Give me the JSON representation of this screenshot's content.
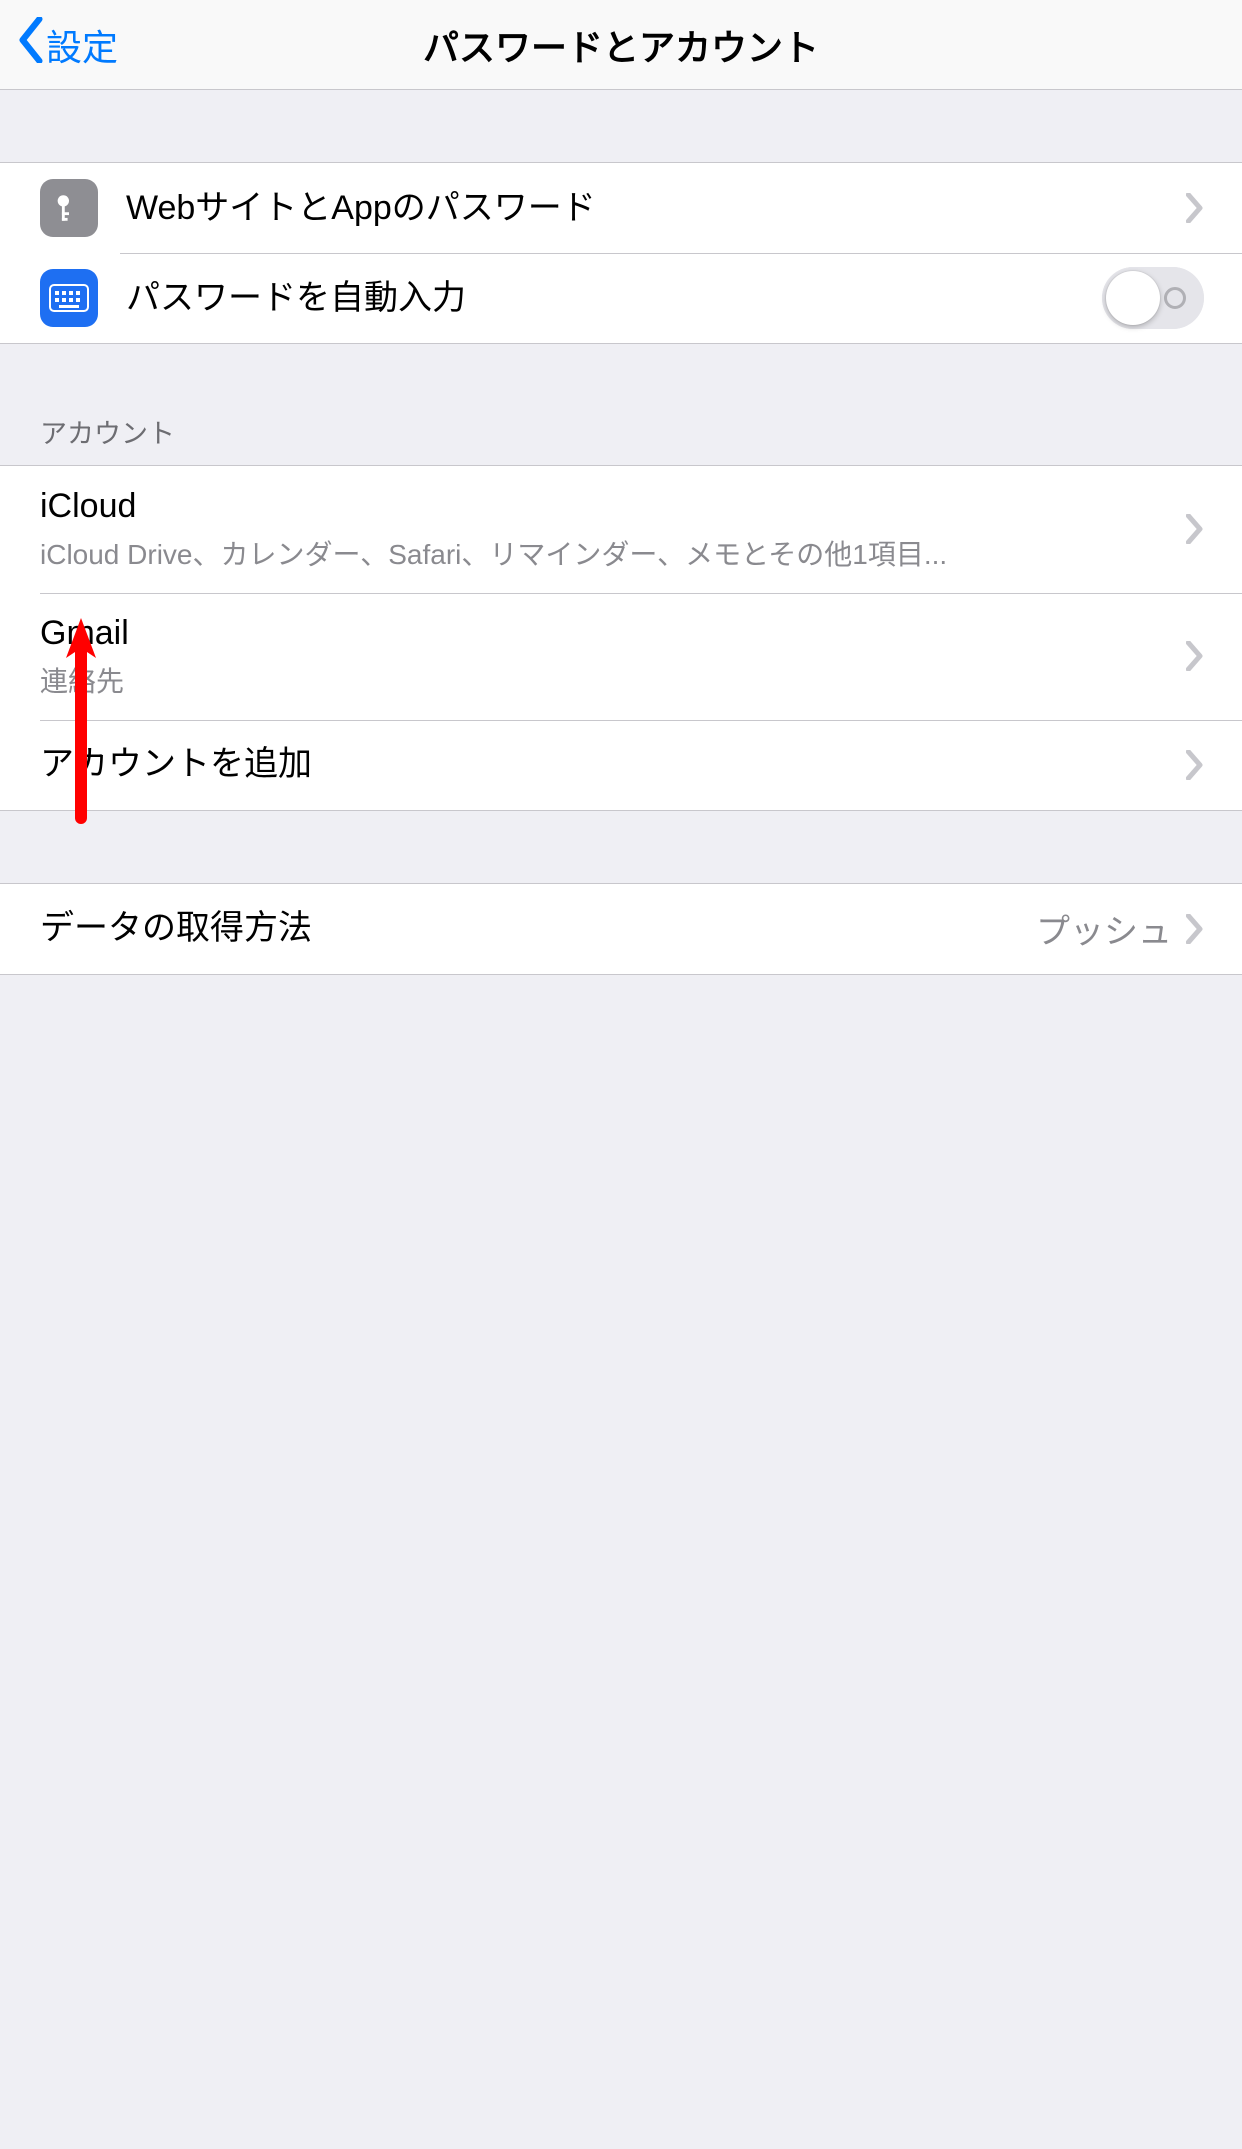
{
  "nav": {
    "back_label": "設定",
    "title": "パスワードとアカウント"
  },
  "passwords": {
    "websites_label": "WebサイトとAppのパスワード",
    "autofill_label": "パスワードを自動入力",
    "autofill_on": false
  },
  "accounts_header": "アカウント",
  "accounts": [
    {
      "title": "iCloud",
      "subtitle": "iCloud Drive、カレンダー、Safari、リマインダー、メモとその他1項目..."
    },
    {
      "title": "Gmail",
      "subtitle": "連絡先"
    }
  ],
  "add_account_label": "アカウントを追加",
  "fetch": {
    "label": "データの取得方法",
    "value": "プッシュ"
  }
}
